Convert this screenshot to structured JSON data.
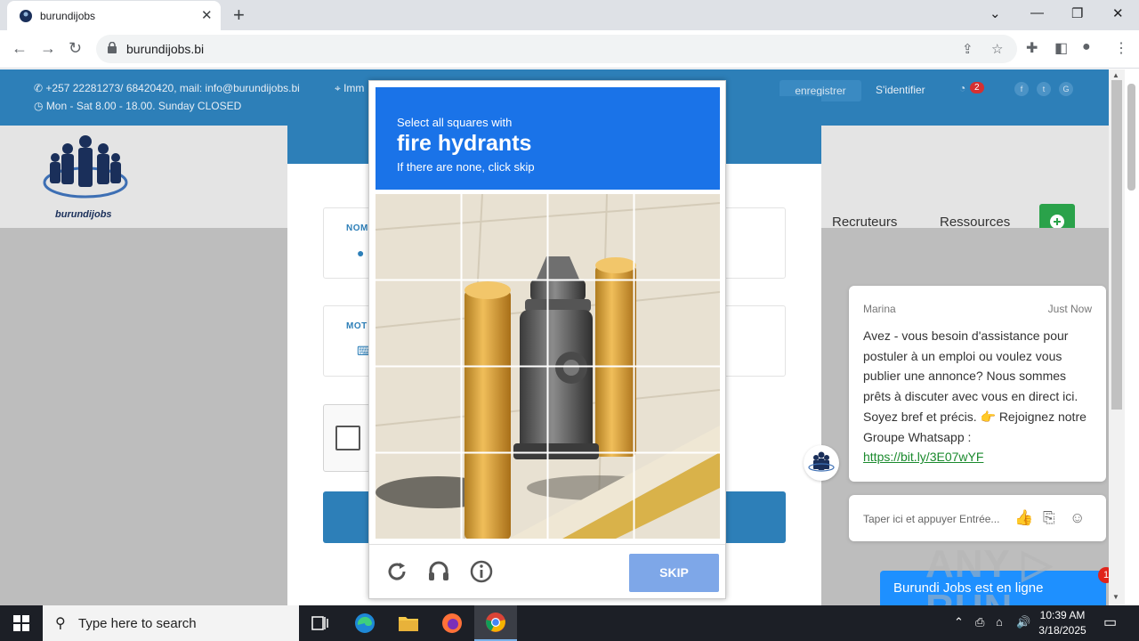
{
  "browser": {
    "tab_title": "burundijobs",
    "url": "burundijobs.bi"
  },
  "site": {
    "contact_line1": "+257 22281273/ 68420420, mail: info@burundijobs.bi",
    "contact_line2": "Mon - Sat 8.00 - 18.00. Sunday CLOSED",
    "address": "Imm",
    "register": "enregistrer",
    "login": "S'identifier",
    "notif_count": "2",
    "logo_text": "burundijobs",
    "menu": [
      "Recruteurs",
      "Ressources"
    ],
    "add_button": "+",
    "field1_label": "NOM",
    "field2_label": "MOT"
  },
  "captcha": {
    "line1": "Select all squares with",
    "line2": "fire hydrants",
    "line3": "If there are none, click skip",
    "skip": "SKIP"
  },
  "chat": {
    "agent": "Marina",
    "time": "Just Now",
    "message": "Avez - vous besoin d'assistance pour postuler à un emploi ou voulez vous publier une annonce? Nous sommes prêts à discuter avec vous en direct ici. Soyez bref et précis. 👉 Rejoignez notre Groupe Whatsapp :",
    "link": "https://bit.ly/3E07wYF",
    "input_placeholder": "Taper ici et appuyer Entrée...",
    "online": "Burundi Jobs est en ligne",
    "badge": "1"
  },
  "watermark": "ANY ▷ RUN",
  "taskbar": {
    "search_placeholder": "Type here to search",
    "time": "10:39 AM",
    "date": "3/18/2025"
  },
  "colors": {
    "site_blue": "#2d7fb8",
    "captcha_blue": "#1a73e8",
    "skip_button": "#7ea7e8",
    "green": "#2aa24a",
    "chat_online": "#1e90ff"
  }
}
